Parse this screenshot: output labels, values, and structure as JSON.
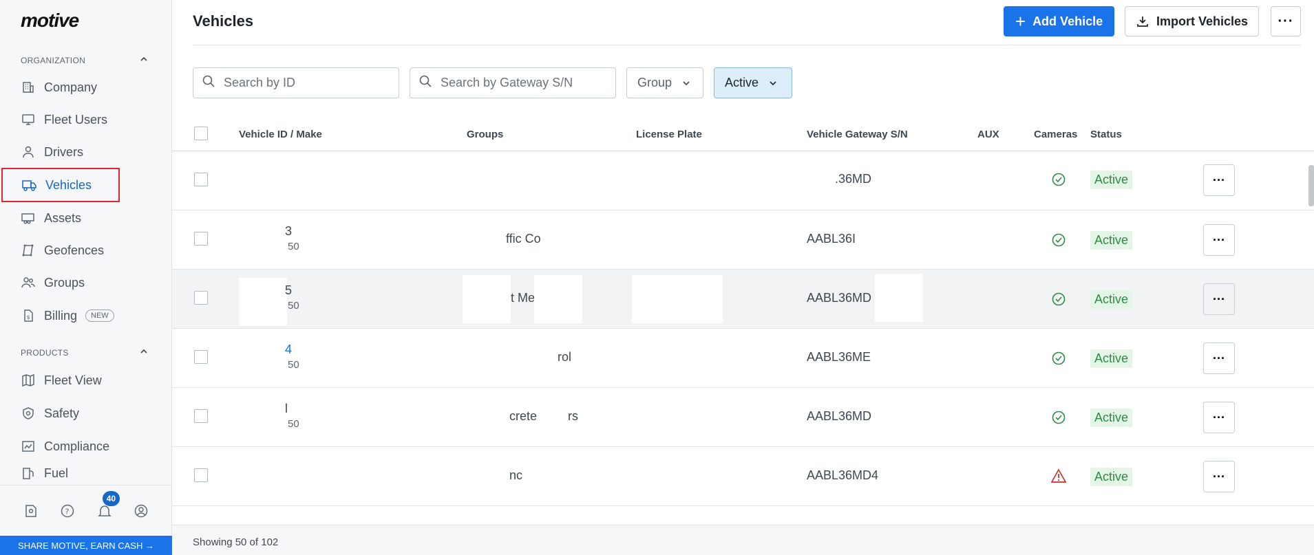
{
  "brand": {
    "logo": "motive"
  },
  "sidebar": {
    "organization_header": "ORGANIZATION",
    "products_header": "PRODUCTS",
    "org_items": [
      {
        "label": "Company",
        "icon": "building-icon"
      },
      {
        "label": "Fleet Users",
        "icon": "monitor-icon"
      },
      {
        "label": "Drivers",
        "icon": "person-icon"
      },
      {
        "label": "Vehicles",
        "icon": "truck-icon",
        "active": true
      },
      {
        "label": "Assets",
        "icon": "trailer-icon"
      },
      {
        "label": "Geofences",
        "icon": "geofence-icon"
      },
      {
        "label": "Groups",
        "icon": "users-icon"
      },
      {
        "label": "Billing",
        "icon": "billing-icon",
        "badge": "NEW"
      }
    ],
    "product_items": [
      {
        "label": "Fleet View",
        "icon": "map-icon"
      },
      {
        "label": "Safety",
        "icon": "shield-icon"
      },
      {
        "label": "Compliance",
        "icon": "compliance-icon"
      },
      {
        "label": "Fuel",
        "icon": "fuel-icon"
      }
    ],
    "notification_count": "40",
    "share_banner": "SHARE MOTIVE, EARN CASH →"
  },
  "header": {
    "title": "Vehicles",
    "add_label": "Add Vehicle",
    "import_label": "Import Vehicles",
    "more_label": "···"
  },
  "filters": {
    "search_id_placeholder": "Search by ID",
    "search_gateway_placeholder": "Search by Gateway S/N",
    "group_label": "Group",
    "status_label": "Active"
  },
  "table": {
    "columns": {
      "vehicle": "Vehicle ID / Make",
      "groups": "Groups",
      "plate": "License Plate",
      "gateway": "Vehicle Gateway S/N",
      "aux": "AUX",
      "cameras": "Cameras",
      "status": "Status"
    },
    "rows": [
      {
        "id": "",
        "make": "",
        "group": "",
        "gateway": ".36MD",
        "camera": "ok",
        "status": "Active"
      },
      {
        "id": "3",
        "make": "50",
        "group": "ffic Co",
        "gateway": "AABL36I",
        "camera": "ok",
        "status": "Active"
      },
      {
        "id": "5",
        "make": "50",
        "group": "t Me",
        "gateway": "AABL36MD",
        "camera": "ok",
        "status": "Active"
      },
      {
        "id": "4",
        "make": "50",
        "group": "rol",
        "gateway": "AABL36ME",
        "camera": "ok",
        "status": "Active"
      },
      {
        "id": "l",
        "make": "50",
        "group": "crete         rs",
        "gateway": "AABL36MD",
        "camera": "ok",
        "status": "Active"
      },
      {
        "id": "",
        "make": "",
        "group": "nc",
        "gateway": "AABL36MD4",
        "camera": "warn",
        "status": "Active"
      }
    ],
    "row_more_label": "···"
  },
  "footer": {
    "showing": "Showing 50 of 102"
  }
}
